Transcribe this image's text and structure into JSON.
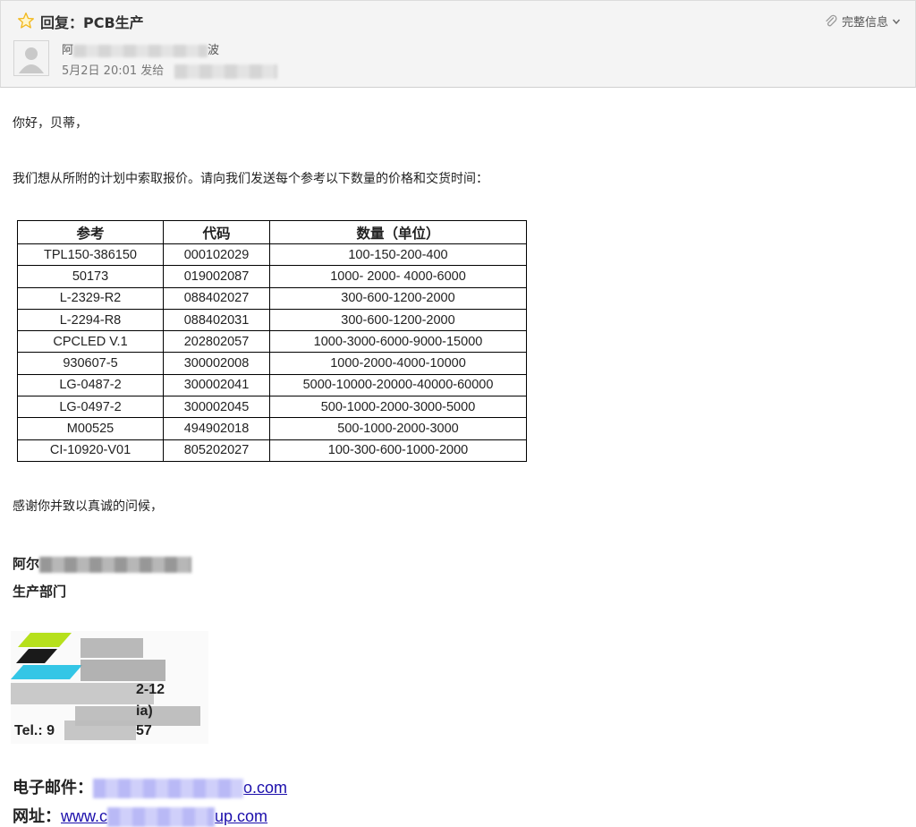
{
  "header": {
    "subject": "回复：PCB生产",
    "full_info_label": "完整信息",
    "sender_prefix": "阿",
    "sender_suffix": "波",
    "date": "5月2日 20:01",
    "sent_to_label": "发给"
  },
  "body": {
    "greeting": "你好，贝蒂，",
    "request": "我们想从所附的计划中索取报价。请向我们发送每个参考以下数量的价格和交货时间：",
    "closing": "感谢你并致以真诚的问候，"
  },
  "table": {
    "headers": [
      "参考",
      "代码",
      "数量（单位）"
    ],
    "rows": [
      [
        "TPL150-386150",
        "000102029",
        "100-150-200-400"
      ],
      [
        "50173",
        "019002087",
        "1000- 2000- 4000-6000"
      ],
      [
        "L-2329-R2",
        "088402027",
        "300-600-1200-2000"
      ],
      [
        "L-2294-R8",
        "088402031",
        "300-600-1200-2000"
      ],
      [
        "CPCLED V.1",
        "202802057",
        "1000-3000-6000-9000-15000"
      ],
      [
        "930607-5",
        "300002008",
        "1000-2000-4000-10000"
      ],
      [
        "LG-0487-2",
        "300002041",
        "5000-10000-20000-40000-60000"
      ],
      [
        "LG-0497-2",
        "300002045",
        "500-1000-2000-3000-5000"
      ],
      [
        "M00525",
        "494902018",
        "500-1000-2000-3000"
      ],
      [
        "CI-10920-V01",
        "805202027",
        "100-300-600-1000-2000"
      ]
    ]
  },
  "signature": {
    "name_prefix": "阿尔",
    "department": "生产部门",
    "logo_fragments": {
      "tel": "Tel.: 9",
      "tel_end": "57",
      "num": "2-12",
      "ia": "ia)"
    },
    "email_label": "电子邮件：",
    "email_visible_end": "o.com",
    "website_label": "网址：",
    "website_start": "www.c",
    "website_end": "up.com"
  },
  "colors": {
    "header_bg": "#f4f4f4",
    "star": "#f2b81e",
    "link": "#1a0dab",
    "logo_green": "#b6e01c",
    "logo_cyan": "#34c6e6"
  }
}
